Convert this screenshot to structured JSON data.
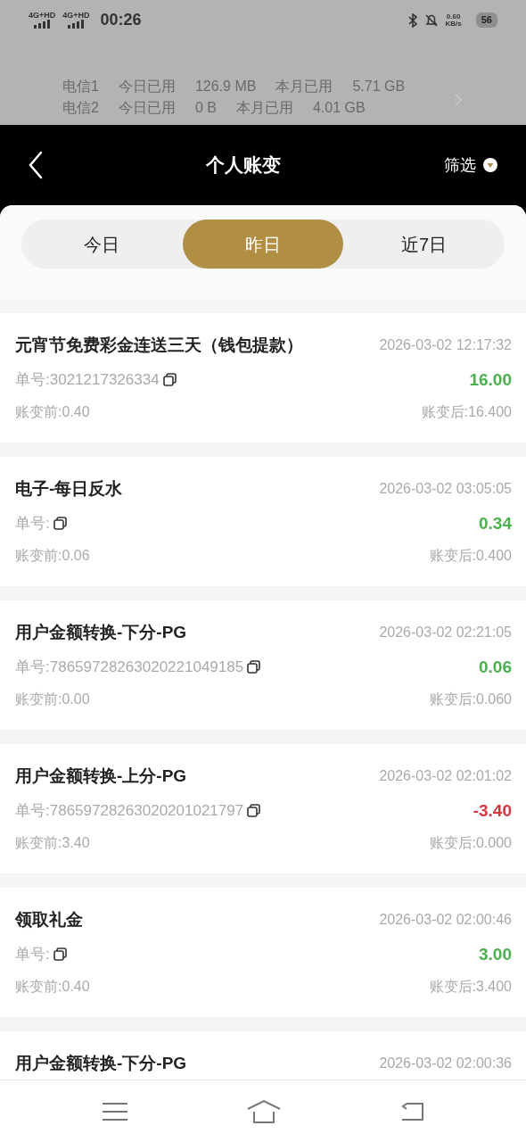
{
  "status_bar": {
    "signals": [
      "4G+HD",
      "4G+HD"
    ],
    "time": "00:26",
    "speed": "0.60",
    "speed_unit": "KB/s",
    "battery": "56"
  },
  "data_notice": [
    {
      "sim": "电信1",
      "today_label": "今日已用",
      "today": "126.9 MB",
      "month_label": "本月已用",
      "month": "5.71 GB"
    },
    {
      "sim": "电信2",
      "today_label": "今日已用",
      "today": "0 B",
      "month_label": "本月已用",
      "month": "4.01 GB"
    }
  ],
  "header": {
    "title": "个人账变",
    "filter": "筛选"
  },
  "tabs": [
    {
      "label": "今日",
      "selected": false
    },
    {
      "label": "昨日",
      "selected": true
    },
    {
      "label": "近7日",
      "selected": false
    }
  ],
  "records": [
    {
      "title": "元宵节免费彩金连送三天（钱包提款）",
      "time": "2026-03-02 12:17:32",
      "order": "单号:3021217326334",
      "amount": "16.00",
      "color": "#4caf50",
      "before": "账变前:0.40",
      "after": "账变后:16.400"
    },
    {
      "title": "电子-每日反水",
      "time": "2026-03-02 03:05:05",
      "order": "单号:",
      "amount": "0.34",
      "color": "#4caf50",
      "before": "账变前:0.06",
      "after": "账变后:0.400"
    },
    {
      "title": "用户金额转换-下分-PG",
      "time": "2026-03-02 02:21:05",
      "order": "单号:78659728263020221049185",
      "amount": "0.06",
      "color": "#4caf50",
      "before": "账变前:0.00",
      "after": "账变后:0.060"
    },
    {
      "title": "用户金额转换-上分-PG",
      "time": "2026-03-02 02:01:02",
      "order": "单号:78659728263020201021797",
      "amount": "-3.40",
      "color": "#d4373f",
      "before": "账变前:3.40",
      "after": "账变后:0.000"
    },
    {
      "title": "领取礼金",
      "time": "2026-03-02 02:00:46",
      "order": "单号:",
      "amount": "3.00",
      "color": "#4caf50",
      "before": "账变前:0.40",
      "after": "账变后:3.400"
    },
    {
      "title": "用户金额转换-下分-PG",
      "time": "2026-03-02 02:00:36"
    }
  ]
}
